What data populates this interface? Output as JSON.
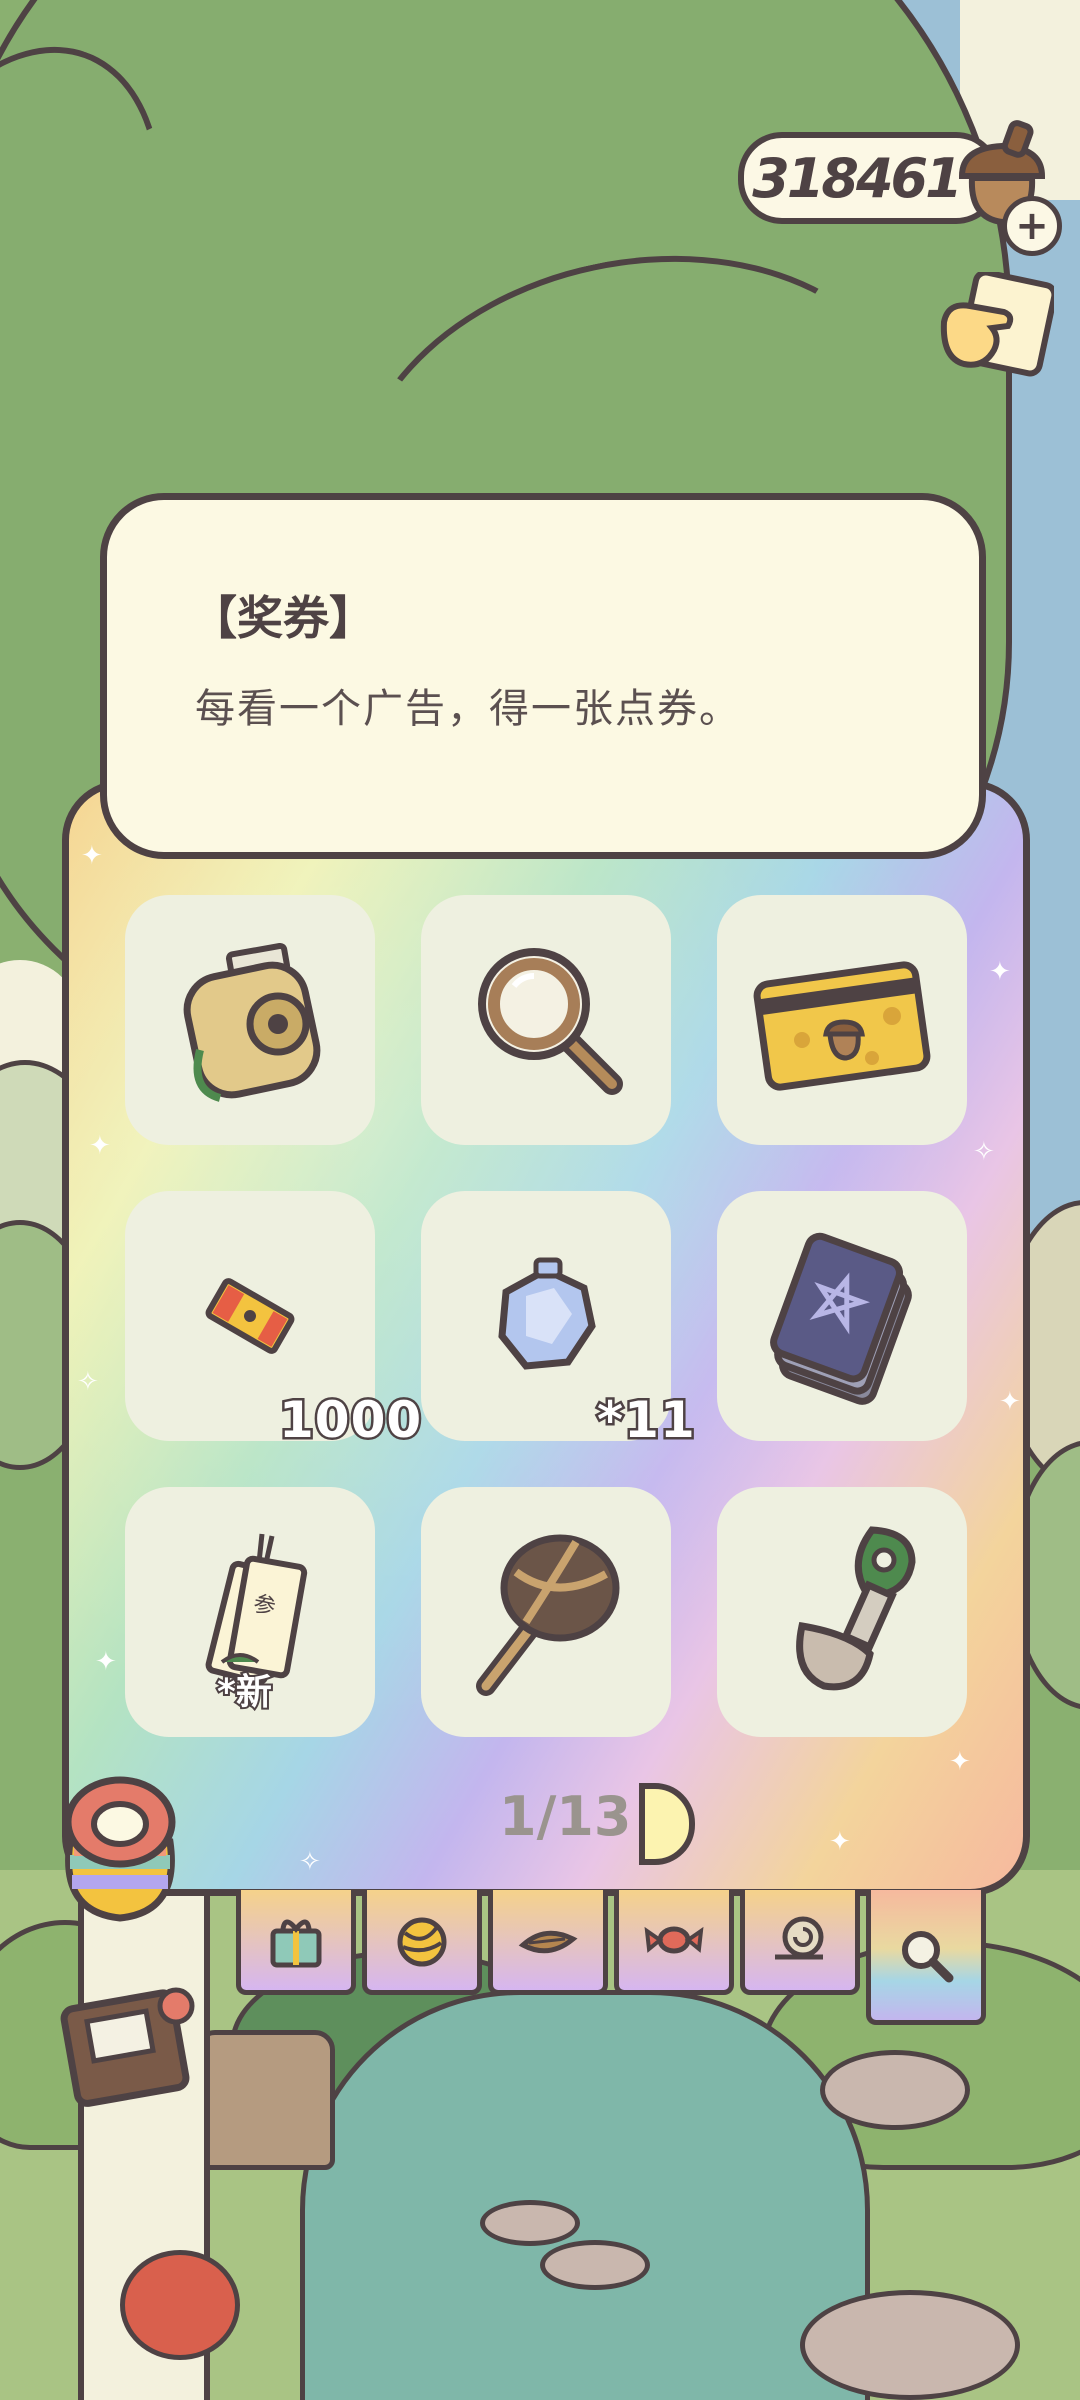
{
  "currency": {
    "acorns": "318461",
    "icon": "acorn-icon",
    "add_icon": "plus-icon"
  },
  "side_button": {
    "icon": "hand-pointer-icon"
  },
  "tooltip": {
    "title": "【奖券】",
    "description": "每看一个广告，得一张点券。"
  },
  "inventory": {
    "items": [
      {
        "icon": "camera-icon",
        "quantity": "",
        "tag": ""
      },
      {
        "icon": "magnifier-icon",
        "quantity": "",
        "tag": ""
      },
      {
        "icon": "card-icon",
        "quantity": "",
        "tag": ""
      },
      {
        "icon": "ticket-icon",
        "quantity": "1000",
        "tag": ""
      },
      {
        "icon": "gem-icon",
        "quantity": "*11",
        "tag": ""
      },
      {
        "icon": "tarot-cards-icon",
        "quantity": "",
        "tag": ""
      },
      {
        "icon": "fortune-slips-icon",
        "quantity": "",
        "tag": "*新"
      },
      {
        "icon": "rattle-icon",
        "quantity": "",
        "tag": ""
      },
      {
        "icon": "shovel-icon",
        "quantity": "",
        "tag": ""
      }
    ],
    "page": "1/13"
  },
  "tabs": [
    {
      "icon": "gift-icon",
      "active": false
    },
    {
      "icon": "yarn-icon",
      "active": false
    },
    {
      "icon": "leaf-icon",
      "active": false
    },
    {
      "icon": "candy-icon",
      "active": false
    },
    {
      "icon": "snail-icon",
      "active": false
    },
    {
      "icon": "magnifier-tab-icon",
      "active": true
    }
  ],
  "colors": {
    "outline": "#4e4244",
    "bubble": "#fcf9e3",
    "slot": "#eef0e0",
    "tree": "#86ad6f"
  }
}
